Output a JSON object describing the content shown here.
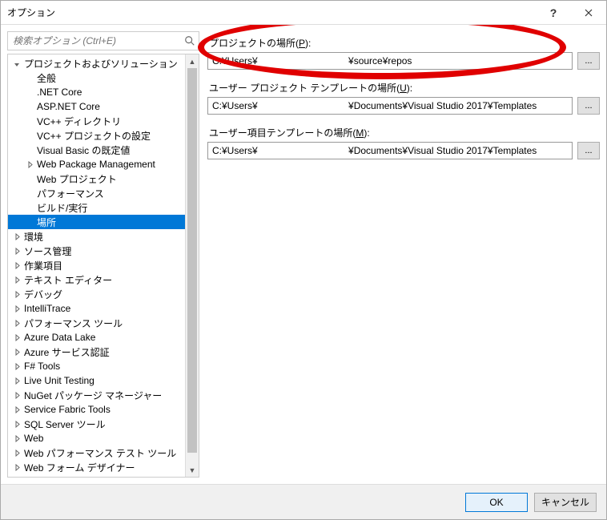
{
  "window": {
    "title": "オプション"
  },
  "search": {
    "placeholder": "検索オプション (Ctrl+E)"
  },
  "tree": [
    {
      "label": "プロジェクトおよびソリューション",
      "level": 0,
      "exp": "open",
      "sel": false
    },
    {
      "label": "全般",
      "level": 1,
      "exp": "none",
      "sel": false
    },
    {
      "label": ".NET Core",
      "level": 1,
      "exp": "none",
      "sel": false
    },
    {
      "label": "ASP.NET Core",
      "level": 1,
      "exp": "none",
      "sel": false
    },
    {
      "label": "VC++ ディレクトリ",
      "level": 1,
      "exp": "none",
      "sel": false
    },
    {
      "label": "VC++ プロジェクトの設定",
      "level": 1,
      "exp": "none",
      "sel": false
    },
    {
      "label": "Visual Basic の既定値",
      "level": 1,
      "exp": "none",
      "sel": false
    },
    {
      "label": "Web Package Management",
      "level": 1,
      "exp": "closed",
      "sel": false
    },
    {
      "label": "Web プロジェクト",
      "level": 1,
      "exp": "none",
      "sel": false
    },
    {
      "label": "パフォーマンス",
      "level": 1,
      "exp": "none",
      "sel": false
    },
    {
      "label": "ビルド/実行",
      "level": 1,
      "exp": "none",
      "sel": false
    },
    {
      "label": "場所",
      "level": 1,
      "exp": "none",
      "sel": true
    },
    {
      "label": "環境",
      "level": 0,
      "exp": "closed",
      "sel": false
    },
    {
      "label": "ソース管理",
      "level": 0,
      "exp": "closed",
      "sel": false
    },
    {
      "label": "作業項目",
      "level": 0,
      "exp": "closed",
      "sel": false
    },
    {
      "label": "テキスト エディター",
      "level": 0,
      "exp": "closed",
      "sel": false
    },
    {
      "label": "デバッグ",
      "level": 0,
      "exp": "closed",
      "sel": false
    },
    {
      "label": "IntelliTrace",
      "level": 0,
      "exp": "closed",
      "sel": false
    },
    {
      "label": "パフォーマンス ツール",
      "level": 0,
      "exp": "closed",
      "sel": false
    },
    {
      "label": "Azure Data Lake",
      "level": 0,
      "exp": "closed",
      "sel": false
    },
    {
      "label": "Azure サービス認証",
      "level": 0,
      "exp": "closed",
      "sel": false
    },
    {
      "label": "F# Tools",
      "level": 0,
      "exp": "closed",
      "sel": false
    },
    {
      "label": "Live Unit Testing",
      "level": 0,
      "exp": "closed",
      "sel": false
    },
    {
      "label": "NuGet パッケージ マネージャー",
      "level": 0,
      "exp": "closed",
      "sel": false
    },
    {
      "label": "Service Fabric Tools",
      "level": 0,
      "exp": "closed",
      "sel": false
    },
    {
      "label": "SQL Server ツール",
      "level": 0,
      "exp": "closed",
      "sel": false
    },
    {
      "label": "Web",
      "level": 0,
      "exp": "closed",
      "sel": false
    },
    {
      "label": "Web パフォーマンス テスト ツール",
      "level": 0,
      "exp": "closed",
      "sel": false
    },
    {
      "label": "Web フォーム デザイナー",
      "level": 0,
      "exp": "closed",
      "sel": false
    }
  ],
  "fields": {
    "projects": {
      "label_pre": "プロジェクトの場所(",
      "accel": "P",
      "label_post": "):",
      "value": "C:¥Users¥                                  ¥source¥repos"
    },
    "userProject": {
      "label_pre": "ユーザー プロジェクト テンプレートの場所(",
      "accel": "U",
      "label_post": "):",
      "value": "C:¥Users¥                                  ¥Documents¥Visual Studio 2017¥Templates"
    },
    "userItem": {
      "label_pre": "ユーザー項目テンプレートの場所(",
      "accel": "M",
      "label_post": "):",
      "value": "C:¥Users¥                                  ¥Documents¥Visual Studio 2017¥Templates"
    },
    "browse": "..."
  },
  "buttons": {
    "ok": "OK",
    "cancel": "キャンセル"
  }
}
